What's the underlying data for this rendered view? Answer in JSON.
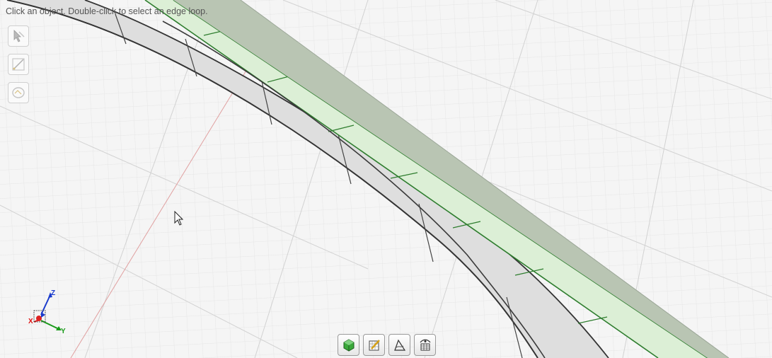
{
  "status": {
    "hint": "Click an object. Double-click to select an edge loop."
  },
  "left_tools": [
    {
      "name": "select-tool",
      "icon": "select-arrow-icon"
    },
    {
      "name": "edge-tool",
      "icon": "edge-select-icon"
    },
    {
      "name": "loop-tool",
      "icon": "loop-select-icon"
    }
  ],
  "bottom_toolbar": [
    {
      "name": "solid-view-button",
      "icon": "green-cube-icon"
    },
    {
      "name": "edit-surface-button",
      "icon": "pencil-grid-icon"
    },
    {
      "name": "analysis-button",
      "icon": "surface-analysis-icon"
    },
    {
      "name": "visibility-button",
      "icon": "eye-mesh-icon"
    }
  ],
  "axis_triad": {
    "x": "X",
    "y": "Y",
    "z": "Z"
  },
  "colors": {
    "background": "#f4f4f4",
    "grid_minor": "#e2e2e2",
    "grid_major": "#d0d0d0",
    "selection_green": "#2e7d2e",
    "selected_fill": "#dcefd6",
    "band_fill": "#b8c4b2",
    "ribbon_fill": "#dcdcdc"
  }
}
